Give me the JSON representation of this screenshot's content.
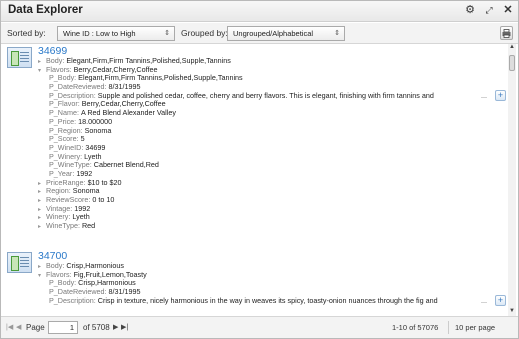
{
  "window": {
    "title": "Data Explorer"
  },
  "titlebar_icons": [
    "gear-icon",
    "expand-icon",
    "close-icon"
  ],
  "toolbar": {
    "sorted_by_label": "Sorted by:",
    "sort_value": "Wine ID : Low to High",
    "grouped_by_label": "Grouped by:",
    "group_value": "Ungrouped/Alphabetical"
  },
  "records": [
    {
      "id": "34699",
      "body": {
        "label": "Body:",
        "value": "Elegant,Firm,Firm Tannins,Polished,Supple,Tannins"
      },
      "flavors": {
        "label": "Flavors:",
        "value": "Berry,Cedar,Cherry,Coffee"
      },
      "sub_fields": [
        {
          "label": "P_Body:",
          "value": "Elegant,Firm,Firm Tannins,Polished,Supple,Tannins"
        },
        {
          "label": "P_DateReviewed:",
          "value": "8/31/1995"
        },
        {
          "label": "P_Description:",
          "value": "Supple and polished cedar, coffee, cherry and berry flavors. This is elegant, finishing with firm tannins and"
        },
        {
          "label": "P_Flavor:",
          "value": "Berry,Cedar,Cherry,Coffee"
        },
        {
          "label": "P_Name:",
          "value": "A Red Blend Alexander Valley"
        },
        {
          "label": "P_Price:",
          "value": "18.000000"
        },
        {
          "label": "P_Region:",
          "value": "Sonoma"
        },
        {
          "label": "P_Score:",
          "value": "5"
        },
        {
          "label": "P_WineID:",
          "value": "34699"
        },
        {
          "label": "P_Winery:",
          "value": "Lyeth"
        },
        {
          "label": "P_WineType:",
          "value": "Cabernet Blend,Red"
        },
        {
          "label": "P_Year:",
          "value": "1992"
        }
      ],
      "more_fields": [
        {
          "label": "PriceRange:",
          "value": "$10 to $20"
        },
        {
          "label": "Region:",
          "value": "Sonoma"
        },
        {
          "label": "ReviewScore:",
          "value": "0 to 10"
        },
        {
          "label": "Vintage:",
          "value": "1992"
        },
        {
          "label": "Winery:",
          "value": "Lyeth"
        },
        {
          "label": "WineType:",
          "value": "Red"
        }
      ]
    },
    {
      "id": "34700",
      "body": {
        "label": "Body:",
        "value": "Crisp,Harmonious"
      },
      "flavors": {
        "label": "Flavors:",
        "value": "Fig,Fruit,Lemon,Toasty"
      },
      "sub_fields": [
        {
          "label": "P_Body:",
          "value": "Crisp,Harmonious"
        },
        {
          "label": "P_DateReviewed:",
          "value": "8/31/1995"
        },
        {
          "label": "P_Description:",
          "value": "Crisp in texture, nicely harmonious in the way in weaves its spicy, toasty-onion nuances through the fig and"
        }
      ],
      "more_fields": []
    }
  ],
  "ellipsis": "...",
  "footer": {
    "page_label": "Page",
    "page_value": "1",
    "of_pages": "of 5708",
    "range": "1-10 of 57076",
    "per_page": "10 per page"
  }
}
